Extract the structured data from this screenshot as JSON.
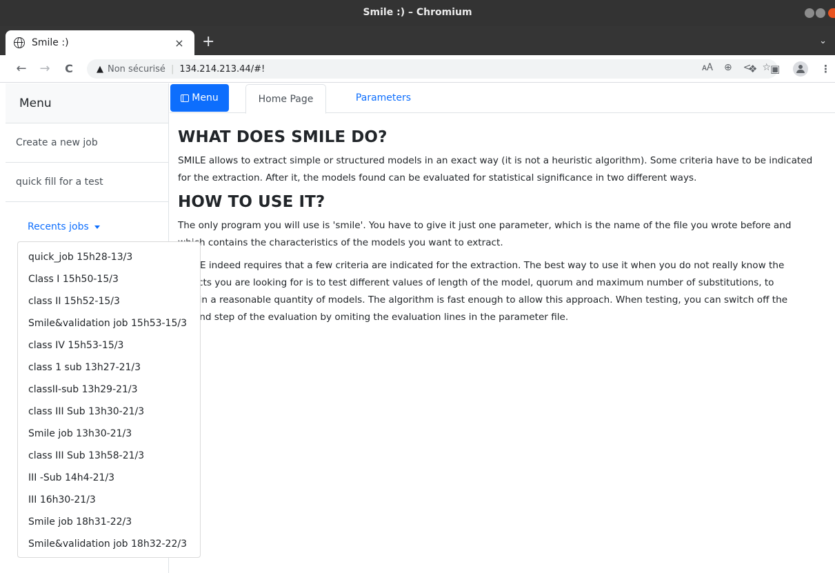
{
  "window": {
    "title": "Smile :) – Chromium"
  },
  "browser": {
    "tab_title": "Smile :)",
    "tab_close": "×",
    "new_tab": "+",
    "tab_menu": "⌄",
    "back": "←",
    "forward": "→",
    "reload": "C",
    "security_warning": "▲",
    "security_label": "Non sécurisé",
    "url": "134.214.213.44/#!",
    "icons": [
      "translate-icon",
      "zoom-icon",
      "share-icon",
      "bookmark-star-icon",
      "reading-list-icon",
      "extensions-icon",
      "side-panel-icon",
      "profile-avatar-icon",
      "more-menu-icon"
    ]
  },
  "sidebar": {
    "header": "Menu",
    "items": [
      {
        "label": "Create a new job"
      },
      {
        "label": "quick fill for a test"
      }
    ],
    "recents_label": "Recents jobs"
  },
  "recent_jobs": [
    "quick_job 15h28-13/3",
    "Class I 15h50-15/3",
    "class II 15h52-15/3",
    "Smile&validation job 15h53-15/3",
    "class IV 15h53-15/3",
    "class 1 sub 13h27-21/3",
    "classII-sub 13h29-21/3",
    "class III Sub 13h30-21/3",
    "Smile job 13h30-21/3",
    "class III Sub 13h58-21/3",
    "III -Sub 14h4-21/3",
    "III 16h30-21/3",
    "Smile job 18h31-22/3",
    "Smile&validation job 18h32-22/3"
  ],
  "nav": {
    "menu_button": "Menu",
    "tabs": [
      {
        "label": "Home Page",
        "active": true
      },
      {
        "label": "Parameters",
        "active": false
      }
    ]
  },
  "article": {
    "heading1": "WHAT DOES SMILE DO?",
    "para1_line1": "SMILE allows to extract simple or structured models in an exact way (it is not a heuristic algorithm). Some criteria have to be indicated",
    "para1_line2": "for the extraction. After it, the models found can be evaluated for statistical significance in two different ways.",
    "heading2": "HOW TO USE IT?",
    "para2_line1": "The only program you will use is 'smile'. You have to give it just one parameter, which is the name of the file you wrote before and",
    "para2_line2": "which contains the characteristics of the models you want to extract.",
    "para3_line1": "SMILE indeed requires that a few criteria are indicated for the extraction. The best way to use it when you do not really know the",
    "para3_line2": "objects you are looking for is to test different values of length of the model, quorum and maximum number of substitutions, to",
    "para3_line3": "obtain a reasonable quantity of models. The algorithm is fast enough to allow this approach. When testing, you can switch off the",
    "para3_line4": "second step of the evaluation by omiting the evaluation lines in the parameter file."
  },
  "colors": {
    "primary": "#0d6efd",
    "titlebar": "#333333",
    "tabstrip": "#353535",
    "close_button": "#e95420"
  }
}
